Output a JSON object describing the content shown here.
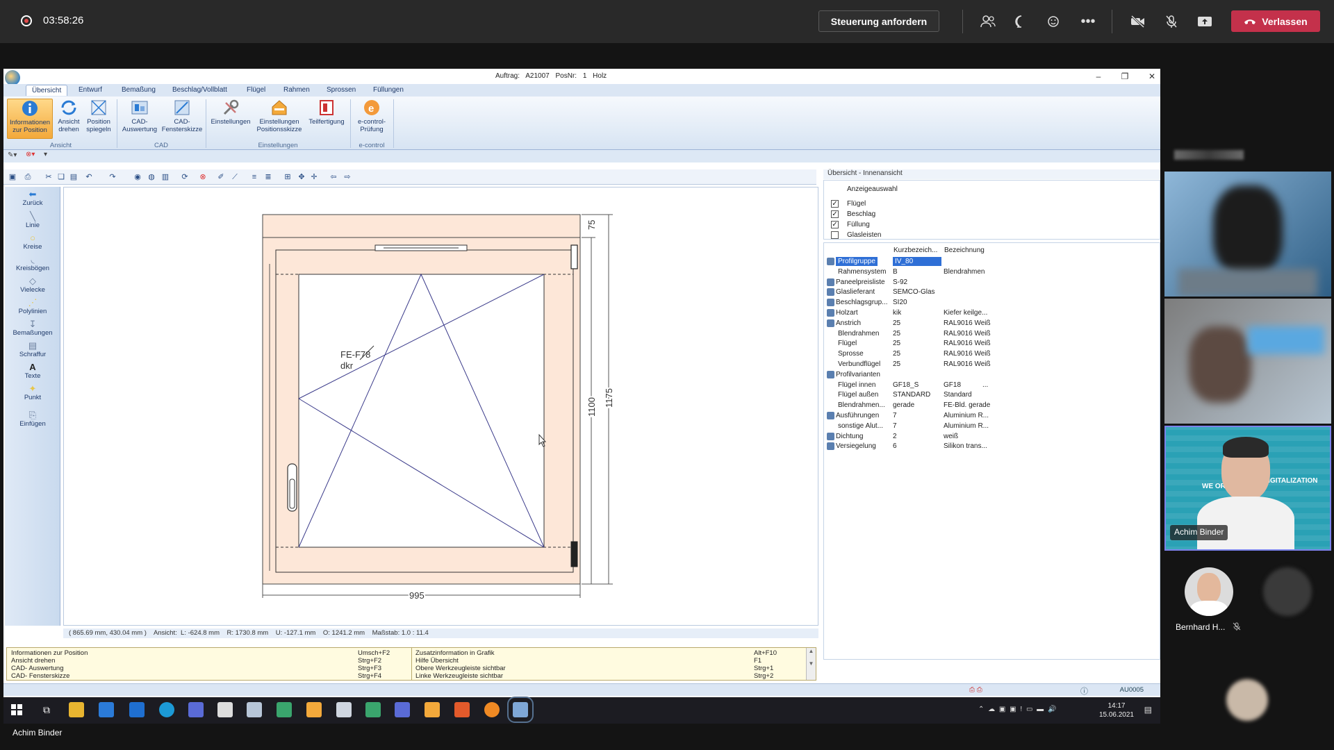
{
  "meeting": {
    "recording_time": "03:58:26",
    "request_control_label": "Steuerung anfordern",
    "leave_label": "Verlassen",
    "presenter_name": "Achim Binder",
    "participants": [
      {
        "name": "Achim Binder"
      },
      {
        "name": "Bernhard H..."
      }
    ]
  },
  "app": {
    "title": "Auftrag: A21007   PosNr: 1        Holz",
    "tabs": [
      "Übersicht",
      "Entwurf",
      "Bemaßung",
      "Beschlag/Vollblatt",
      "Flügel",
      "Rahmen",
      "Sprossen",
      "Füllungen"
    ],
    "ribbon_buttons": [
      {
        "label": "Informationen zur Position",
        "icon": "info-icon",
        "group": "Ansicht"
      },
      {
        "label": "Ansicht drehen",
        "icon": "rotate-icon",
        "group": "Ansicht"
      },
      {
        "label": "Position spiegeln",
        "icon": "mirror-icon",
        "group": "Ansicht"
      },
      {
        "label": "CAD-Auswertung",
        "icon": "cad-evaluation-icon",
        "group": "CAD"
      },
      {
        "label": "CAD-Fensterskizze",
        "icon": "cad-sketch-icon",
        "group": "CAD"
      },
      {
        "label": "Einstellungen",
        "icon": "tools-icon",
        "group": "Einstellungen"
      },
      {
        "label": "Einstellungen Positionsskizze",
        "icon": "house-settings-icon",
        "group": "Einstellungen"
      },
      {
        "label": "Teilfertigung",
        "icon": "part-production-icon",
        "group": "Einstellungen"
      },
      {
        "label": "e-control-Prüfung",
        "icon": "e-control-icon",
        "group": "e-control"
      }
    ],
    "ribbon_groups": [
      "Ansicht",
      "CAD",
      "Einstellungen",
      "e-control"
    ],
    "left_tools": [
      "Zurück",
      "Linie",
      "Kreise",
      "Kreisbögen",
      "Vielecke",
      "Polylinien",
      "Bemaßungen",
      "Schraffur",
      "Texte",
      "Punkt",
      "Einfügen"
    ],
    "drawing": {
      "sash_label": "FE-F78",
      "opening_label": "dkr",
      "dim_width": "995",
      "dim_height_inner": "1100",
      "dim_height_total": "1175",
      "dim_top": "75"
    },
    "status_line": "( 865.69 mm, 430.04 mm )    Ansicht:  L: -624.8 mm    R: 1730.8 mm    U: -127.1 mm    O: 1241.2 mm    Maßstab: 1.0 : 11.4",
    "help_rows": [
      {
        "action": "Informationen zur Position",
        "shortcut": "Umsch+F2",
        "action2": "Zusatzinformation in Grafik",
        "shortcut2": "Alt+F10"
      },
      {
        "action": "Ansicht drehen",
        "shortcut": "Strg+F2",
        "action2": "Hilfe Übersicht",
        "shortcut2": "F1"
      },
      {
        "action": "CAD- Auswertung",
        "shortcut": "Strg+F3",
        "action2": "Obere Werkzeugleiste sichtbar",
        "shortcut2": "Strg+1"
      },
      {
        "action": "CAD- Fensterskizze",
        "shortcut": "Strg+F4",
        "action2": "Linke Werkzeugleiste sichtbar",
        "shortcut2": "Strg+2"
      }
    ],
    "status_code": "AU0005",
    "right_panel": {
      "title": "Übersicht - Innenansicht",
      "display_header": "Anzeigeauswahl",
      "display_options": [
        {
          "label": "Flügel",
          "checked": true
        },
        {
          "label": "Beschlag",
          "checked": true
        },
        {
          "label": "Füllung",
          "checked": true
        },
        {
          "label": "Glasleisten",
          "checked": false
        }
      ],
      "columns": [
        "Kurzbezeich...",
        "Bezeichnung"
      ],
      "properties": [
        {
          "name": "Profilgruppe",
          "kurz": "IV_80",
          "bez": "",
          "indent": false,
          "selected": true
        },
        {
          "name": "Rahmensystem",
          "kurz": "B",
          "bez": "Blendrahmen",
          "indent": true
        },
        {
          "name": "Paneelpreisliste",
          "kurz": "S-92",
          "bez": "",
          "indent": false
        },
        {
          "name": "Glaslieferant",
          "kurz": "SEMCO-Glas",
          "bez": "",
          "indent": false
        },
        {
          "name": "Beschlagsgrup...",
          "kurz": "SI20",
          "bez": "",
          "indent": false
        },
        {
          "name": "Holzart",
          "kurz": "kik",
          "bez": "Kiefer keilge...",
          "indent": false
        },
        {
          "name": "Anstrich",
          "kurz": "25",
          "bez": "RAL9016 Weiß",
          "indent": false
        },
        {
          "name": "Blendrahmen",
          "kurz": "25",
          "bez": "RAL9016 Weiß",
          "indent": true
        },
        {
          "name": "Flügel",
          "kurz": "25",
          "bez": "RAL9016 Weiß",
          "indent": true
        },
        {
          "name": "Sprosse",
          "kurz": "25",
          "bez": "RAL9016 Weiß",
          "indent": true
        },
        {
          "name": "Verbundflügel",
          "kurz": "25",
          "bez": "RAL9016 Weiß",
          "indent": true
        },
        {
          "name": "Profilvarianten",
          "kurz": "",
          "bez": "",
          "indent": false
        },
        {
          "name": "Flügel innen",
          "kurz": "GF18_S",
          "bez": "GF18",
          "indent": true,
          "extra": "..."
        },
        {
          "name": "Flügel außen",
          "kurz": "STANDARD",
          "bez": "Standard",
          "indent": true
        },
        {
          "name": "Blendrahmen...",
          "kurz": "gerade",
          "bez": "FE-Bld. gerade",
          "indent": true
        },
        {
          "name": "Ausführungen",
          "kurz": "7",
          "bez": "Aluminium R...",
          "indent": false
        },
        {
          "name": "sonstige Alut...",
          "kurz": "7",
          "bez": "Aluminium R...",
          "indent": true
        },
        {
          "name": "Dichtung",
          "kurz": "2",
          "bez": "weiß",
          "indent": false
        },
        {
          "name": "Versiegelung",
          "kurz": "6",
          "bez": "Silikon trans...",
          "indent": false
        }
      ]
    },
    "taskbar_time": "14:17",
    "taskbar_date": "15.06.2021",
    "taskbar_user": "Achim Binder"
  },
  "colors": {
    "teams_bar": "#292929",
    "leave_red": "#c4314b",
    "frame_wood": "#fde7d8",
    "drawing_line": "#3a3a8a",
    "ribbon_active": "#f3a93b"
  }
}
